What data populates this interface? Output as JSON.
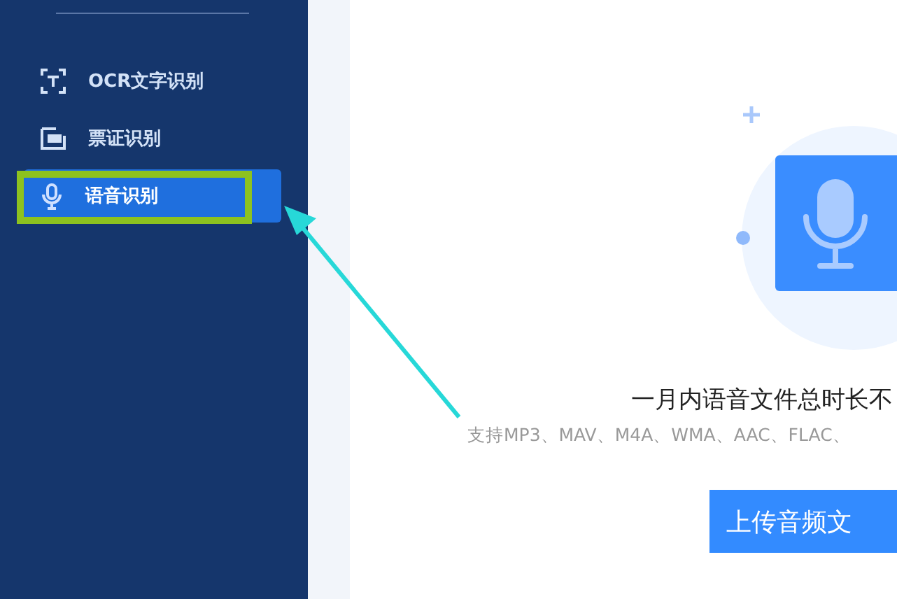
{
  "sidebar": {
    "items": [
      {
        "label": "OCR文字识别",
        "selected": false
      },
      {
        "label": "票证识别",
        "selected": false
      },
      {
        "label": "语音识别",
        "selected": true
      }
    ]
  },
  "main": {
    "heading": "一月内语音文件总时长不",
    "formats": "支持MP3、MAV、M4A、WMA、AAC、FLAC、",
    "upload_button": "上传音频文"
  },
  "annotations": {
    "highlight_box": true,
    "arrow": true
  }
}
